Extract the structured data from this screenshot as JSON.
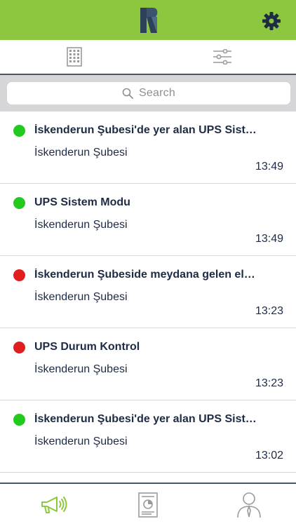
{
  "header": {
    "logo_icon": "n-logo-icon",
    "settings_icon": "gear-icon",
    "bg_color": "#8dc63f"
  },
  "segments": [
    {
      "icon": "building-icon"
    },
    {
      "icon": "sliders-icon"
    }
  ],
  "search": {
    "placeholder": "Search"
  },
  "notifications": [
    {
      "status": "green",
      "color": "#22c91e",
      "title": "İskenderun Şubesi'de yer alan UPS Sist…",
      "subtitle": "İskenderun Şubesi",
      "time": "13:49"
    },
    {
      "status": "green",
      "color": "#22c91e",
      "title": "UPS Sistem Modu",
      "subtitle": "İskenderun Şubesi",
      "time": "13:49"
    },
    {
      "status": "red",
      "color": "#e01e1e",
      "title": "İskenderun Şubeside meydana gelen el…",
      "subtitle": "İskenderun Şubesi",
      "time": "13:23"
    },
    {
      "status": "red",
      "color": "#e01e1e",
      "title": "UPS Durum Kontrol",
      "subtitle": "İskenderun Şubesi",
      "time": "13:23"
    },
    {
      "status": "green",
      "color": "#22c91e",
      "title": "İskenderun Şubesi'de yer alan UPS Sist…",
      "subtitle": "İskenderun Şubesi",
      "time": "13:02"
    }
  ],
  "tabs": [
    {
      "icon": "megaphone-icon",
      "active": true
    },
    {
      "icon": "report-icon",
      "active": false
    },
    {
      "icon": "user-icon",
      "active": false
    }
  ],
  "colors": {
    "accent": "#8dc63f",
    "text": "#1d2b44",
    "icon_gray": "#9a9a9a"
  }
}
